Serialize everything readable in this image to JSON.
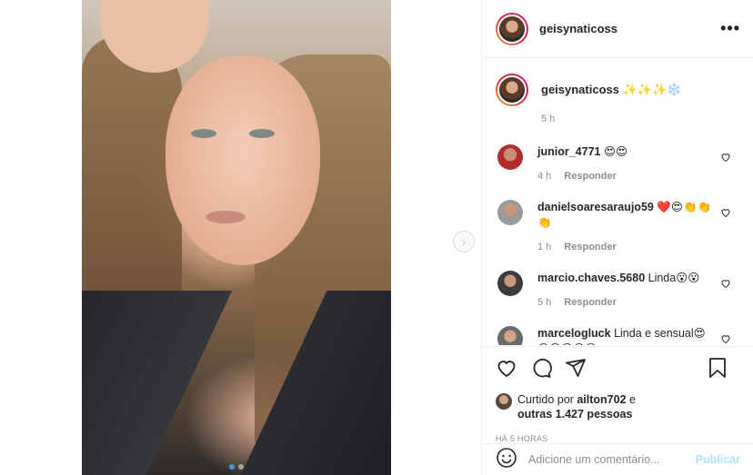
{
  "post": {
    "username": "geisynaticoss",
    "more_label": "•••",
    "next_label": "›"
  },
  "caption": {
    "username": "geisynaticoss",
    "text": "✨✨✨❄️",
    "time": "5 h"
  },
  "comments": [
    {
      "username": "junior_4771",
      "text": "😍😍",
      "extra": "",
      "time": "4 h",
      "reply": "Responder"
    },
    {
      "username": "danielsoaresaraujo59",
      "text": "❤️😍👏👏",
      "extra": "👏",
      "time": "1 h",
      "reply": "Responder"
    },
    {
      "username": "marcio.chaves.5680",
      "text": "Linda😮😮",
      "extra": "",
      "time": "5 h",
      "reply": "Responder"
    },
    {
      "username": "marcelogluck",
      "text": "Linda e sensual😍",
      "extra": "😍😍😍😍😍",
      "time": "",
      "reply": ""
    }
  ],
  "likes": {
    "prefix": "Curtido por",
    "user": "ailton702",
    "middle": "e",
    "others": "outras 1.427 pessoas"
  },
  "time_ago": "HÁ 5 HORAS",
  "comment_box": {
    "placeholder": "Adicione um comentário...",
    "publish": "Publicar"
  },
  "icons": {
    "more": "more-icon",
    "next": "chevron-right-icon",
    "heart": "heart-icon",
    "comment": "comment-icon",
    "share": "share-icon",
    "save": "bookmark-icon",
    "emoji": "emoji-icon"
  },
  "colors": {
    "publish": "#b2dffc",
    "muted": "#8e8e8e",
    "text": "#262626",
    "border": "#efefef"
  }
}
